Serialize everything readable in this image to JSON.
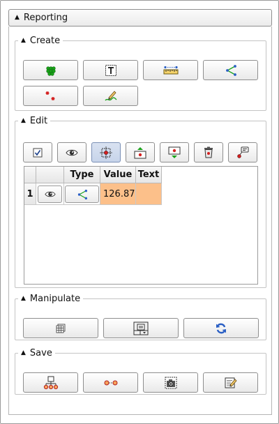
{
  "reporting": {
    "title": "Reporting"
  },
  "create": {
    "title": "Create",
    "buttons": [
      "add-points-icon",
      "text-label-icon",
      "ruler-measure-icon",
      "angle-measure-icon",
      "scatter-markers-icon",
      "freehand-draw-icon"
    ]
  },
  "edit": {
    "title": "Edit",
    "toolbar": [
      "check-all-icon",
      "visibility-eye-icon",
      "center-target-icon",
      "move-up-icon",
      "move-down-icon",
      "delete-trash-icon",
      "annotation-callout-icon"
    ],
    "table": {
      "columns": [
        "",
        "Type",
        "Value",
        "Text"
      ],
      "rows": [
        {
          "index": "1",
          "visible_icon": "eye-icon",
          "type_icon": "angle-measure-icon",
          "value": "126.87",
          "text": ""
        }
      ]
    }
  },
  "manipulate": {
    "title": "Manipulate",
    "buttons": [
      "grid-layout-icon",
      "layout-selector-icon",
      "refresh-icon"
    ]
  },
  "save": {
    "title": "Save",
    "buttons": [
      "hierarchy-export-icon",
      "points-export-icon",
      "screenshot-icon",
      "edit-notes-icon"
    ]
  },
  "colors": {
    "value_cell": "#fcc08a",
    "accent_green": "#1aa21a",
    "accent_red": "#d42020",
    "accent_blue": "#2a5fc4"
  }
}
